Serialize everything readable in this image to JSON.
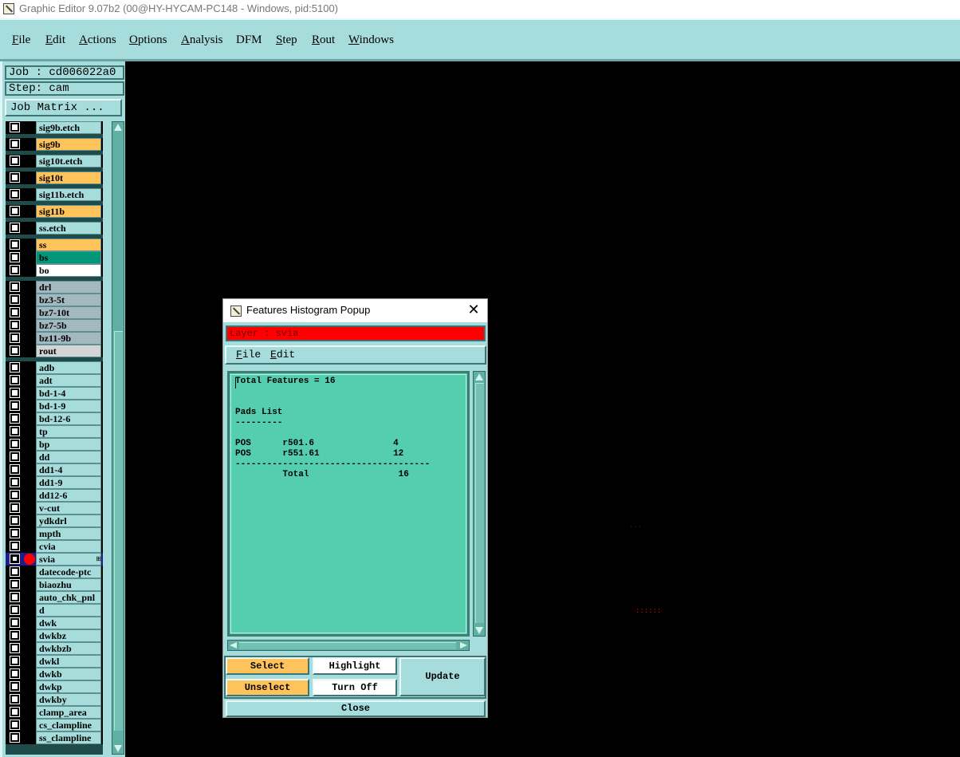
{
  "window": {
    "title": "Graphic Editor 9.07b2 (00@HY-HYCAM-PC148 - Windows, pid:5100)"
  },
  "menu": [
    {
      "key": "F",
      "rest": "ile"
    },
    {
      "key": "E",
      "rest": "dit"
    },
    {
      "key": "A",
      "rest": "ctions"
    },
    {
      "key": "O",
      "rest": "ptions"
    },
    {
      "key": "A",
      "rest": "nalysis"
    },
    {
      "key": "",
      "rest": "DFM"
    },
    {
      "key": "S",
      "rest": "tep"
    },
    {
      "key": "R",
      "rest": "out"
    },
    {
      "key": "W",
      "rest": "indows"
    }
  ],
  "job": {
    "job_label": "Job : cd006022a0",
    "step_label": "Step: cam",
    "matrix_button": "Job Matrix ..."
  },
  "layers": [
    {
      "name": "sig9b.etch",
      "color": "#a7dcdc"
    },
    {
      "name": "sig9b",
      "color": "#ffc35c"
    },
    {
      "name": "sig10t.etch",
      "color": "#a7dcdc"
    },
    {
      "name": "sig10t",
      "color": "#ffc35c"
    },
    {
      "name": "sig11b.etch",
      "color": "#a7dcdc"
    },
    {
      "name": "sig11b",
      "color": "#ffc35c"
    },
    {
      "name": "ss.etch",
      "color": "#a7dcdc"
    },
    {
      "name": "ss",
      "color": "#ffc35c"
    },
    {
      "name": "bs",
      "color": "#00967a"
    },
    {
      "name": "bo",
      "color": "#ffffff"
    },
    {
      "name": "drl",
      "color": "#a3b8bf"
    },
    {
      "name": "bz3-5t",
      "color": "#a3b8bf"
    },
    {
      "name": "bz7-10t",
      "color": "#a3b8bf"
    },
    {
      "name": "bz7-5b",
      "color": "#a3b8bf"
    },
    {
      "name": "bz11-9b",
      "color": "#a3b8bf"
    },
    {
      "name": "rout",
      "color": "#d4d4d4"
    },
    {
      "name": "adb",
      "color": "#a7dcdc"
    },
    {
      "name": "adt",
      "color": "#a7dcdc"
    },
    {
      "name": "bd-1-4",
      "color": "#a7dcdc"
    },
    {
      "name": "bd-1-9",
      "color": "#a7dcdc"
    },
    {
      "name": "bd-12-6",
      "color": "#a7dcdc"
    },
    {
      "name": "tp",
      "color": "#a7dcdc"
    },
    {
      "name": "bp",
      "color": "#a7dcdc"
    },
    {
      "name": "dd",
      "color": "#a7dcdc"
    },
    {
      "name": "dd1-4",
      "color": "#a7dcdc"
    },
    {
      "name": "dd1-9",
      "color": "#a7dcdc"
    },
    {
      "name": "dd12-6",
      "color": "#a7dcdc"
    },
    {
      "name": "v-cut",
      "color": "#a7dcdc"
    },
    {
      "name": "ydkdrl",
      "color": "#a7dcdc"
    },
    {
      "name": "mpth",
      "color": "#a7dcdc"
    },
    {
      "name": "cvia",
      "color": "#a7dcdc"
    },
    {
      "name": "svia",
      "color": "#a7dcdc",
      "active": true
    },
    {
      "name": "datecode-ptc",
      "color": "#a7dcdc"
    },
    {
      "name": "biaozhu",
      "color": "#a7dcdc"
    },
    {
      "name": "auto_chk_pnl",
      "color": "#a7dcdc"
    },
    {
      "name": "d",
      "color": "#a7dcdc"
    },
    {
      "name": "dwk",
      "color": "#a7dcdc"
    },
    {
      "name": "dwkbz",
      "color": "#a7dcdc"
    },
    {
      "name": "dwkbzb",
      "color": "#a7dcdc"
    },
    {
      "name": "dwkl",
      "color": "#a7dcdc"
    },
    {
      "name": "dwkb",
      "color": "#a7dcdc"
    },
    {
      "name": "dwkp",
      "color": "#a7dcdc"
    },
    {
      "name": "dwkby",
      "color": "#a7dcdc"
    },
    {
      "name": "clamp_area",
      "color": "#a7dcdc"
    },
    {
      "name": "cs_clampline",
      "color": "#a7dcdc"
    },
    {
      "name": "ss_clampline",
      "color": "#a7dcdc"
    }
  ],
  "canvas": {
    "mark1": "˙˙˙",
    "mark2": "::::::"
  },
  "popup": {
    "title": "Features Histogram Popup",
    "close_glyph": "✕",
    "layer_label": "Layer :  svia",
    "menu": [
      {
        "key": "F",
        "rest": "ile"
      },
      {
        "key": "E",
        "rest": "dit"
      }
    ],
    "report": {
      "total_line": "Total Features = 16",
      "section_title": "Pads List",
      "section_rule": "---------",
      "rows": [
        {
          "pol": "POS",
          "symbol": "r501.6",
          "count": "4"
        },
        {
          "pol": "POS",
          "symbol": "r551.61",
          "count": "12"
        }
      ],
      "rule": "-------------------------------------",
      "total_label": "Total",
      "total_count": "16"
    },
    "buttons": {
      "select": "Select",
      "unselect": "Unselect",
      "highlight": "Highlight",
      "turn_off": "Turn Off",
      "update": "Update",
      "close": "Close"
    }
  },
  "colors": {
    "panel": "#a7dcdc",
    "text_area": "#55cdaf",
    "layer_bar": "#ff0000",
    "selected": "#ffc35c"
  }
}
